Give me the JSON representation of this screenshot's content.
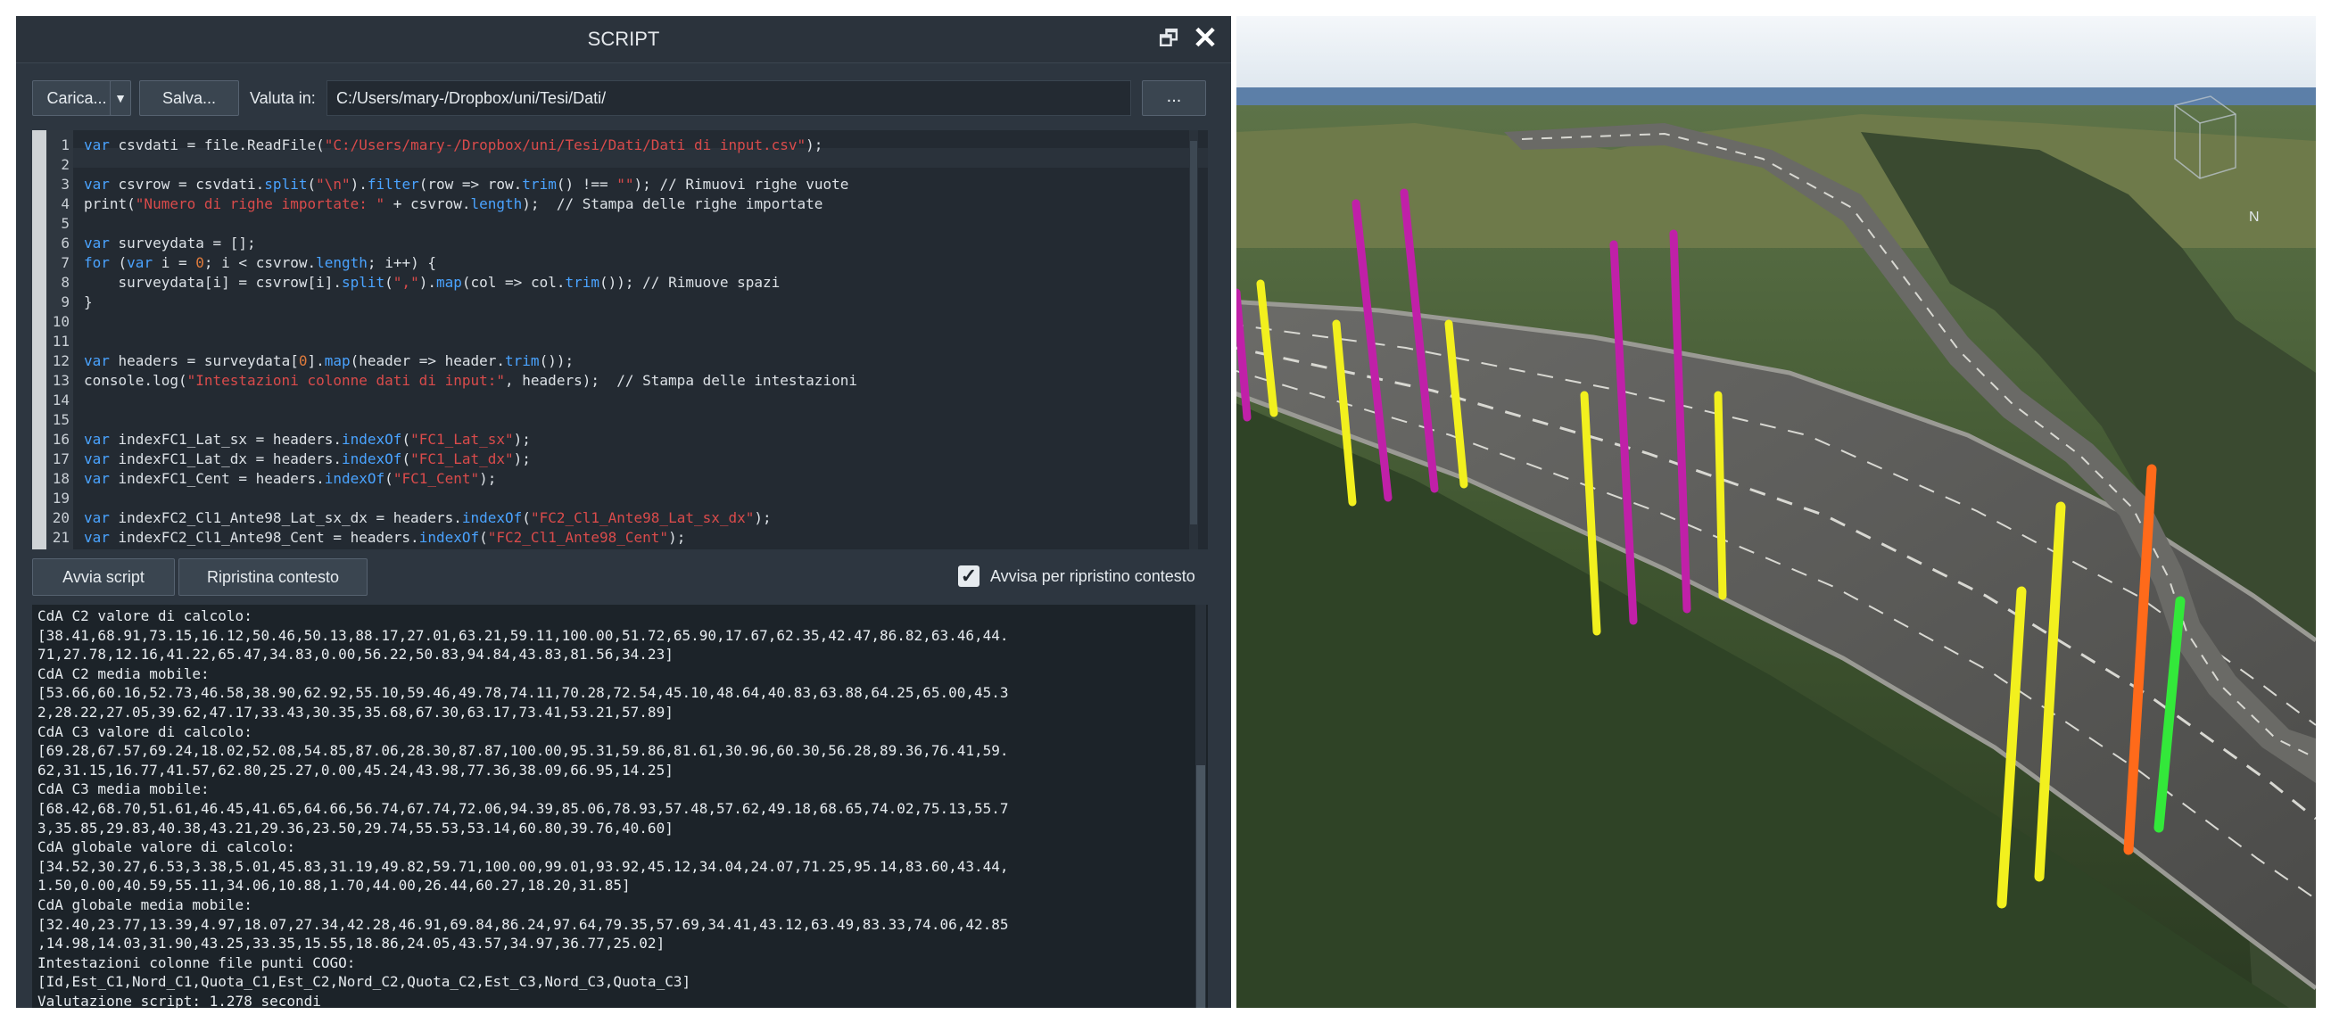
{
  "window": {
    "title": "SCRIPT"
  },
  "toolbar": {
    "load_label": "Carica...",
    "save_label": "Salva...",
    "valuta_label": "Valuta in:",
    "path_value": "C:/Users/mary-/Dropbox/uni/Tesi/Dati/",
    "browse_label": "..."
  },
  "editor": {
    "line_numbers": [
      "1",
      "2",
      "3",
      "4",
      "5",
      "6",
      "7",
      "8",
      "9",
      "10",
      "11",
      "12",
      "13",
      "14",
      "15",
      "16",
      "17",
      "18",
      "19",
      "20",
      "21"
    ],
    "lines": [
      "var csvdati = file.ReadFile(\"C:/Users/mary-/Dropbox/uni/Tesi/Dati/Dati di input.csv\");",
      "",
      "var csvrow = csvdati.split(\"\\n\").filter(row => row.trim() !== \"\"); // Rimuovi righe vuote",
      "print(\"Numero di righe importate: \" + csvrow.length);  // Stampa delle righe importate",
      "",
      "var surveydata = [];",
      "for (var i = 0; i < csvrow.length; i++) {",
      "    surveydata[i] = csvrow[i].split(\",\").map(col => col.trim()); // Rimuove spazi",
      "}",
      "",
      "",
      "var headers = surveydata[0].map(header => header.trim());",
      "console.log(\"Intestazioni colonne dati di input:\", headers);  // Stampa delle intestazioni",
      "",
      "",
      "var indexFC1_Lat_sx = headers.indexOf(\"FC1_Lat_sx\");",
      "var indexFC1_Lat_dx = headers.indexOf(\"FC1_Lat_dx\");",
      "var indexFC1_Cent = headers.indexOf(\"FC1_Cent\");",
      "",
      "var indexFC2_Cl1_Ante98_Lat_sx_dx = headers.indexOf(\"FC2_Cl1_Ante98_Lat_sx_dx\");",
      "var indexFC2_Cl1_Ante98_Cent = headers.indexOf(\"FC2_Cl1_Ante98_Cent\");"
    ]
  },
  "actions": {
    "run_label": "Avvia script",
    "reset_label": "Ripristina contesto",
    "checkbox_label": "Avvisa per ripristino contesto",
    "checkbox_checked": true
  },
  "console": {
    "lines": [
      "CdA C2 valore di calcolo:",
      "[38.41,68.91,73.15,16.12,50.46,50.13,88.17,27.01,63.21,59.11,100.00,51.72,65.90,17.67,62.35,42.47,86.82,63.46,44.",
      "71,27.78,12.16,41.22,65.47,34.83,0.00,56.22,50.83,94.84,43.83,81.56,34.23]",
      "CdA C2 media mobile:",
      "[53.66,60.16,52.73,46.58,38.90,62.92,55.10,59.46,49.78,74.11,70.28,72.54,45.10,48.64,40.83,63.88,64.25,65.00,45.3",
      "2,28.22,27.05,39.62,47.17,33.43,30.35,35.68,67.30,63.17,73.41,53.21,57.89]",
      "CdA C3 valore di calcolo:",
      "[69.28,67.57,69.24,18.02,52.08,54.85,87.06,28.30,87.87,100.00,95.31,59.86,81.61,30.96,60.30,56.28,89.36,76.41,59.",
      "62,31.15,16.77,41.57,62.80,25.27,0.00,45.24,43.98,77.36,38.09,66.95,14.25]",
      "CdA C3 media mobile:",
      "[68.42,68.70,51.61,46.45,41.65,64.66,56.74,67.74,72.06,94.39,85.06,78.93,57.48,57.62,49.18,68.65,74.02,75.13,55.7",
      "3,35.85,29.83,40.38,43.21,29.36,23.50,29.74,55.53,53.14,60.80,39.76,40.60]",
      "CdA globale valore di calcolo:",
      "[34.52,30.27,6.53,3.38,5.01,45.83,31.19,49.82,59.71,100.00,99.01,93.92,45.12,34.04,24.07,71.25,95.14,83.60,43.44,",
      "1.50,0.00,40.59,55.11,34.06,10.88,1.70,44.00,26.44,60.27,18.20,31.85]",
      "CdA globale media mobile:",
      "[32.40,23.77,13.39,4.97,18.07,27.34,42.28,46.91,69.84,86.24,97.64,79.35,57.69,34.41,43.12,63.49,83.33,74.06,42.85",
      ",14.98,14.03,31.90,43.25,33.35,15.55,18.86,24.05,43.57,34.97,36.77,25.02]",
      "Intestazioni colonne file punti COGO:",
      "[Id,Est_C1,Nord_C1,Quota_C1,Est_C2,Nord_C2,Quota_C2,Est_C3,Nord_C3,Quota_C3]",
      "Valutazione script: 1.278 secondi"
    ]
  },
  "viewport": {
    "compass_label": "N",
    "marker_colors": {
      "yellow": "#f2f01e",
      "magenta": "#c020a8",
      "orange": "#ff6a1a",
      "green": "#33e83a"
    }
  }
}
